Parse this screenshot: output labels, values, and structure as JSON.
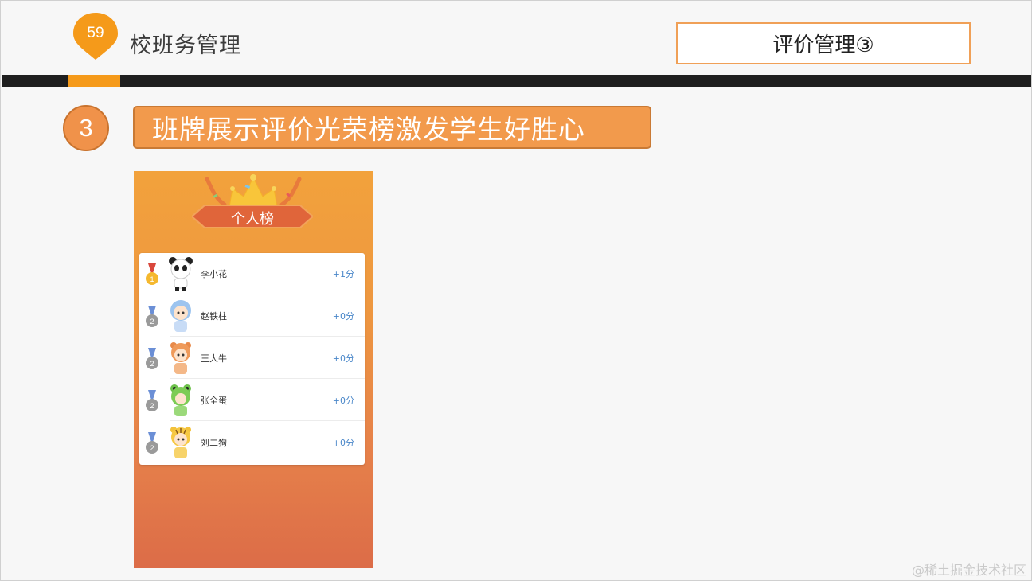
{
  "header": {
    "page_number": "59",
    "section_title": "校班务管理",
    "top_right_label": "评价管理③"
  },
  "subtitle": {
    "number": "3",
    "text": "班牌展示评价光荣榜激发学生好胜心"
  },
  "leaderboard": {
    "title": "个人榜",
    "entries": [
      {
        "name": "李小花",
        "score": "+1分",
        "medal": "gold",
        "medal_rank": "1",
        "avatar": "panda-avatar-icon"
      },
      {
        "name": "赵铁柱",
        "score": "+0分",
        "medal": "silver",
        "medal_rank": "2",
        "avatar": "blue-hair-avatar-icon"
      },
      {
        "name": "王大牛",
        "score": "+0分",
        "medal": "silver",
        "medal_rank": "2",
        "avatar": "tiger-avatar-icon"
      },
      {
        "name": "张全蛋",
        "score": "+0分",
        "medal": "silver",
        "medal_rank": "2",
        "avatar": "frog-avatar-icon"
      },
      {
        "name": "刘二狗",
        "score": "+0分",
        "medal": "silver",
        "medal_rank": "2",
        "avatar": "yellow-tiger-avatar-icon"
      }
    ]
  },
  "watermark": "@稀土掘金技术社区",
  "colors": {
    "accent_orange": "#f59a1a",
    "subtitle_orange": "#f29a4c",
    "score_blue": "#4a87c9",
    "bar_black": "#1f1f1f"
  }
}
